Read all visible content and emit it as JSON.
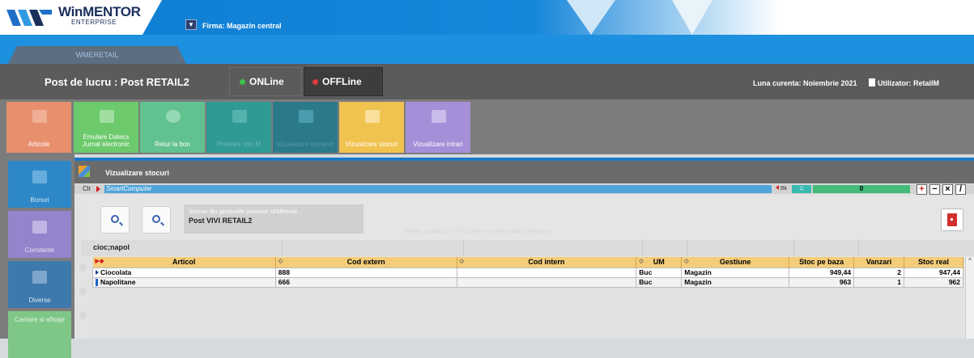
{
  "app": {
    "logo_main": "WinMENTOR",
    "logo_sub": "ENTERPRISE",
    "firm_label": "Firma:  Magazin central"
  },
  "tab": {
    "label": "WMERETAIL"
  },
  "status": {
    "post": "Post de lucru : Post  RETAIL2",
    "online": "ONLine",
    "offline": "OFFLine",
    "luna": "Luna curenta: Noiembrie 2021",
    "utilizator": "Utilizator: RetailM"
  },
  "tiles": [
    {
      "label": "Articole"
    },
    {
      "label": "Emulare Datecs Jurnal electronic"
    },
    {
      "label": "Retur la bon"
    },
    {
      "label": "Preluare Info M"
    },
    {
      "label": "Vizualizare comenzi"
    },
    {
      "label": "Vizualizare stocuri"
    },
    {
      "label": "Vizualizare intrari"
    }
  ],
  "leftnav": [
    {
      "label": "Bonuri"
    },
    {
      "label": "Constante"
    },
    {
      "label": "Diverse"
    },
    {
      "label": "Cantare si afisaje"
    }
  ],
  "window": {
    "title": "Vizualizare stocuri"
  },
  "cmdbar": {
    "clr": "Clr",
    "input": "SmartComputer",
    "bk": "Bk",
    "eq": "=",
    "count": "0"
  },
  "stock": {
    "subtitle": "Stocuri din gestiunile postului: WMRetail...",
    "post": "Post VIVI RETAIL2",
    "hint": "Introdu conditia (F3 / F6) pentru sa vedea stocul articolului"
  },
  "filter": {
    "text": "cioc;napol"
  },
  "grid": {
    "columns": [
      "Articol",
      "Cod extern",
      "Cod intern",
      "UM",
      "Gestiune",
      "Stoc pe baza",
      "Vanzari",
      "Stoc real"
    ],
    "rows": [
      [
        "Ciocolata",
        "888",
        "",
        "Buc",
        "Magazin",
        "949,44",
        "2",
        "947,44"
      ],
      [
        "Napolitane",
        "666",
        "",
        "Buc",
        "Magazin",
        "963",
        "1",
        "962"
      ]
    ]
  },
  "ops": {
    "plus": "+",
    "minus": "−",
    "times": "×",
    "edit": "/"
  }
}
